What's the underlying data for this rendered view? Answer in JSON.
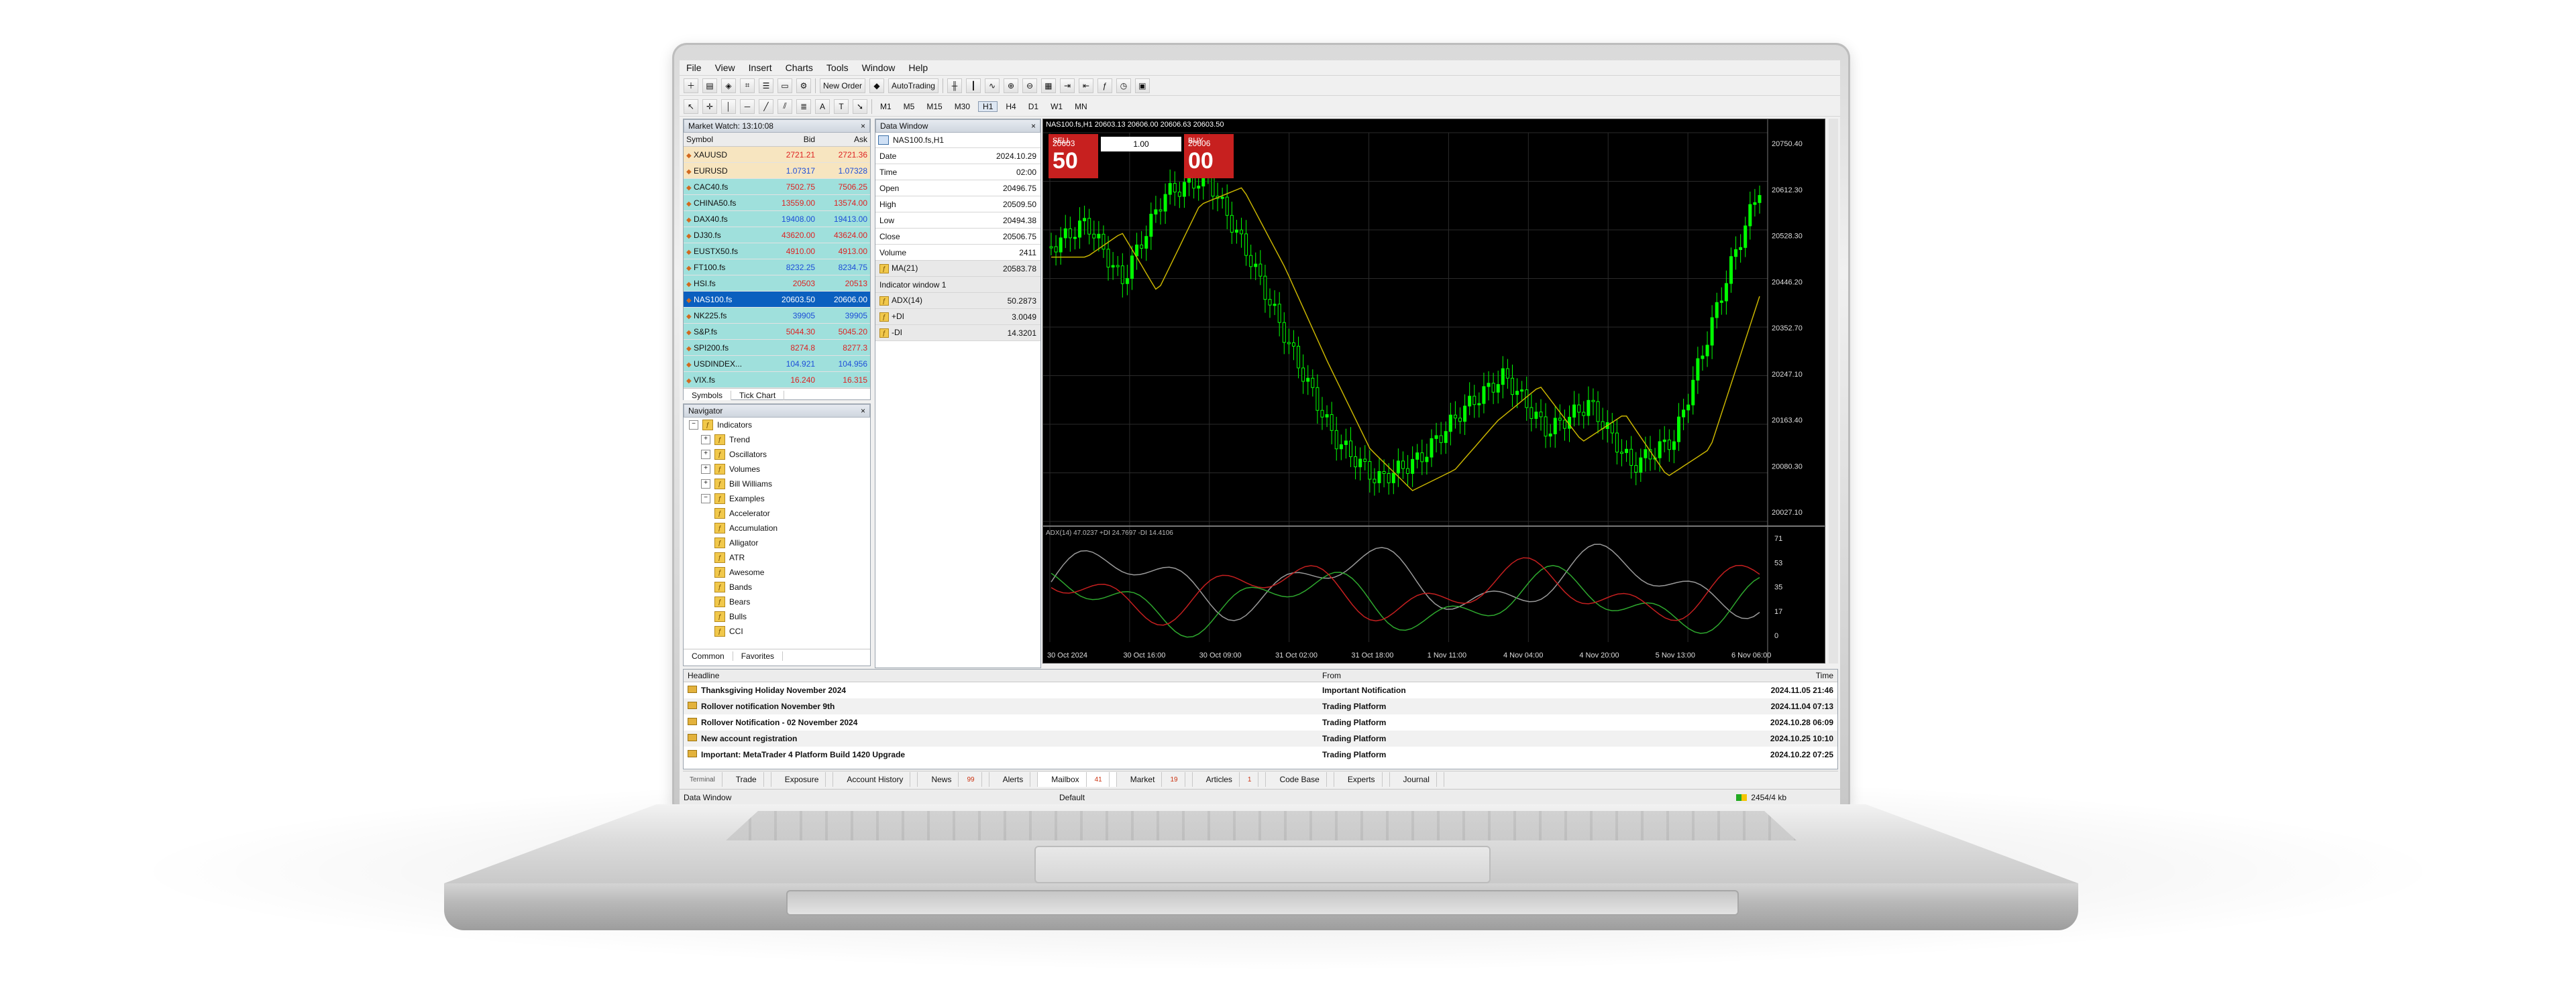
{
  "menu": [
    "File",
    "View",
    "Insert",
    "Charts",
    "Tools",
    "Window",
    "Help"
  ],
  "toolbar": {
    "new_order": "New Order",
    "autotrading": "AutoTrading"
  },
  "timeframes": [
    "M1",
    "M5",
    "M15",
    "M30",
    "H1",
    "H4",
    "D1",
    "W1",
    "MN"
  ],
  "market_watch": {
    "title": "Market Watch: 13:10:08",
    "headers": [
      "Symbol",
      "Bid",
      "Ask"
    ],
    "rows": [
      {
        "symbol": "XAUUSD",
        "bid": "2721.21",
        "ask": "2721.36"
      },
      {
        "symbol": "EURUSD",
        "bid": "1.07317",
        "ask": "1.07328"
      },
      {
        "symbol": "CAC40.fs",
        "bid": "7502.75",
        "ask": "7506.25"
      },
      {
        "symbol": "CHINA50.fs",
        "bid": "13559.00",
        "ask": "13574.00"
      },
      {
        "symbol": "DAX40.fs",
        "bid": "19408.00",
        "ask": "19413.00"
      },
      {
        "symbol": "DJ30.fs",
        "bid": "43620.00",
        "ask": "43624.00"
      },
      {
        "symbol": "EUSTX50.fs",
        "bid": "4910.00",
        "ask": "4913.00"
      },
      {
        "symbol": "FT100.fs",
        "bid": "8232.25",
        "ask": "8234.75"
      },
      {
        "symbol": "HSI.fs",
        "bid": "20503",
        "ask": "20513"
      },
      {
        "symbol": "NAS100.fs",
        "bid": "20603.50",
        "ask": "20606.00"
      },
      {
        "symbol": "NK225.fs",
        "bid": "39905",
        "ask": "39905"
      },
      {
        "symbol": "S&P.fs",
        "bid": "5044.30",
        "ask": "5045.20"
      },
      {
        "symbol": "SPI200.fs",
        "bid": "8274.8",
        "ask": "8277.3"
      },
      {
        "symbol": "USDINDEX...",
        "bid": "104.921",
        "ask": "104.956"
      },
      {
        "symbol": "VIX.fs",
        "bid": "16.240",
        "ask": "16.315"
      }
    ],
    "tabs": [
      "Symbols",
      "Tick Chart"
    ]
  },
  "navigator": {
    "title": "Navigator",
    "items": [
      "Indicators",
      "Trend",
      "Oscillators",
      "Volumes",
      "Bill Williams",
      "Examples",
      "Accelerator",
      "Accumulation",
      "Alligator",
      "ATR",
      "Awesome",
      "Bands",
      "Bears",
      "Bulls",
      "CCI"
    ],
    "tabs": [
      "Common",
      "Favorites"
    ]
  },
  "data_window": {
    "title": "Data Window",
    "symbol": "NAS100.fs,H1",
    "rows": [
      {
        "k": "Date",
        "v": "2024.10.29"
      },
      {
        "k": "Time",
        "v": "02:00"
      },
      {
        "k": "Open",
        "v": "20496.75"
      },
      {
        "k": "High",
        "v": "20509.50"
      },
      {
        "k": "Low",
        "v": "20494.38"
      },
      {
        "k": "Close",
        "v": "20506.75"
      },
      {
        "k": "Volume",
        "v": "2411"
      },
      {
        "k": "MA(21)",
        "v": "20583.78"
      },
      {
        "k": "Indicator window 1",
        "v": ""
      },
      {
        "k": "ADX(14)",
        "v": "50.2873"
      },
      {
        "k": "+DI",
        "v": "3.0049"
      },
      {
        "k": "-DI",
        "v": "14.3201"
      }
    ]
  },
  "chart": {
    "header": "NAS100.fs,H1  20603.13 20606.00 20606.63 20603.50",
    "lots": "1.00",
    "sell_label": "SELL",
    "buy_label": "BUY",
    "sell_small": "20603",
    "sell_big": "50",
    "buy_small": "20606",
    "buy_big": "00",
    "price_ticks": [
      "20750.40",
      "20612.30",
      "20528.30",
      "20446.20",
      "20352.70",
      "20247.10",
      "20163.40",
      "20080.30",
      "20027.10"
    ],
    "sub_header": "ADX(14) 47.0237 +DI 24.7697 -DI 14.4106",
    "sub_ticks": [
      "71",
      "53",
      "35",
      "17",
      "0"
    ],
    "time_ticks": [
      "30 Oct 2024",
      "30 Oct 16:00",
      "30 Oct 09:00",
      "31 Oct 02:00",
      "31 Oct 18:00",
      "1 Nov 11:00",
      "4 Nov 04:00",
      "4 Nov 20:00",
      "5 Nov 13:00",
      "6 Nov 06:00"
    ]
  },
  "terminal": {
    "headers": [
      "Headline",
      "From",
      "Time"
    ],
    "rows": [
      {
        "headline": "Thanksgiving Holiday November 2024",
        "from": "Important Notification",
        "time": "2024.11.05 21:46"
      },
      {
        "headline": "Rollover notification November 9th",
        "from": "Trading Platform",
        "time": "2024.11.04 07:13"
      },
      {
        "headline": "Rollover Notification - 02 November 2024",
        "from": "Trading Platform",
        "time": "2024.10.28 06:09"
      },
      {
        "headline": "New account registration",
        "from": "Trading Platform",
        "time": "2024.10.25 10:10"
      },
      {
        "headline": "Important: MetaTrader 4 Platform Build 1420 Upgrade",
        "from": "Trading Platform",
        "time": "2024.10.22 07:25"
      }
    ],
    "tabs": [
      {
        "label": "Trade",
        "badge": ""
      },
      {
        "label": "Exposure",
        "badge": ""
      },
      {
        "label": "Account History",
        "badge": ""
      },
      {
        "label": "News",
        "badge": "99"
      },
      {
        "label": "Alerts",
        "badge": ""
      },
      {
        "label": "Mailbox",
        "badge": "41"
      },
      {
        "label": "Market",
        "badge": "19"
      },
      {
        "label": "Articles",
        "badge": "1"
      },
      {
        "label": "Code Base",
        "badge": ""
      },
      {
        "label": "Experts",
        "badge": ""
      },
      {
        "label": "Journal",
        "badge": ""
      }
    ],
    "side_label": "Terminal"
  },
  "status": {
    "left": "Data Window",
    "center": "Default",
    "right": "2454/4 kb"
  },
  "colors": {
    "bull_candle": "#00ff00",
    "ma_line": "#c8b400",
    "sell_red": "#c7201f",
    "selection_blue": "#0b5fbf"
  }
}
